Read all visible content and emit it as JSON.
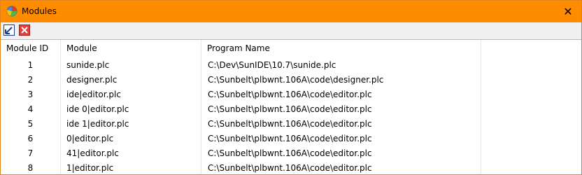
{
  "window": {
    "title": "Modules",
    "close_glyph": "✕",
    "accent_color": "#ff8c00"
  },
  "toolbar": {
    "buttons": [
      {
        "icon": "arrow-down-left-icon",
        "label": ""
      },
      {
        "icon": "red-x-icon",
        "label": ""
      }
    ]
  },
  "table": {
    "columns": [
      "Module ID",
      "Module",
      "Program Name"
    ],
    "rows": [
      {
        "id": "1",
        "module": "sunide.plc",
        "program": "C:\\Dev\\SunIDE\\10.7\\sunide.plc"
      },
      {
        "id": "2",
        "module": "designer.plc",
        "program": "C:\\Sunbelt\\plbwnt.106A\\code\\designer.plc"
      },
      {
        "id": "3",
        "module": "ide|editor.plc",
        "program": "C:\\Sunbelt\\plbwnt.106A\\code\\editor.plc"
      },
      {
        "id": "4",
        "module": "ide 0|editor.plc",
        "program": "C:\\Sunbelt\\plbwnt.106A\\code\\editor.plc"
      },
      {
        "id": "5",
        "module": "ide 1|editor.plc",
        "program": "C:\\Sunbelt\\plbwnt.106A\\code\\editor.plc"
      },
      {
        "id": "6",
        "module": "0|editor.plc",
        "program": "C:\\Sunbelt\\plbwnt.106A\\code\\editor.plc"
      },
      {
        "id": "7",
        "module": "41|editor.plc",
        "program": "C:\\Sunbelt\\plbwnt.106A\\code\\editor.plc"
      },
      {
        "id": "8",
        "module": "1|editor.plc",
        "program": "C:\\Sunbelt\\plbwnt.106A\\code\\editor.plc"
      }
    ]
  }
}
